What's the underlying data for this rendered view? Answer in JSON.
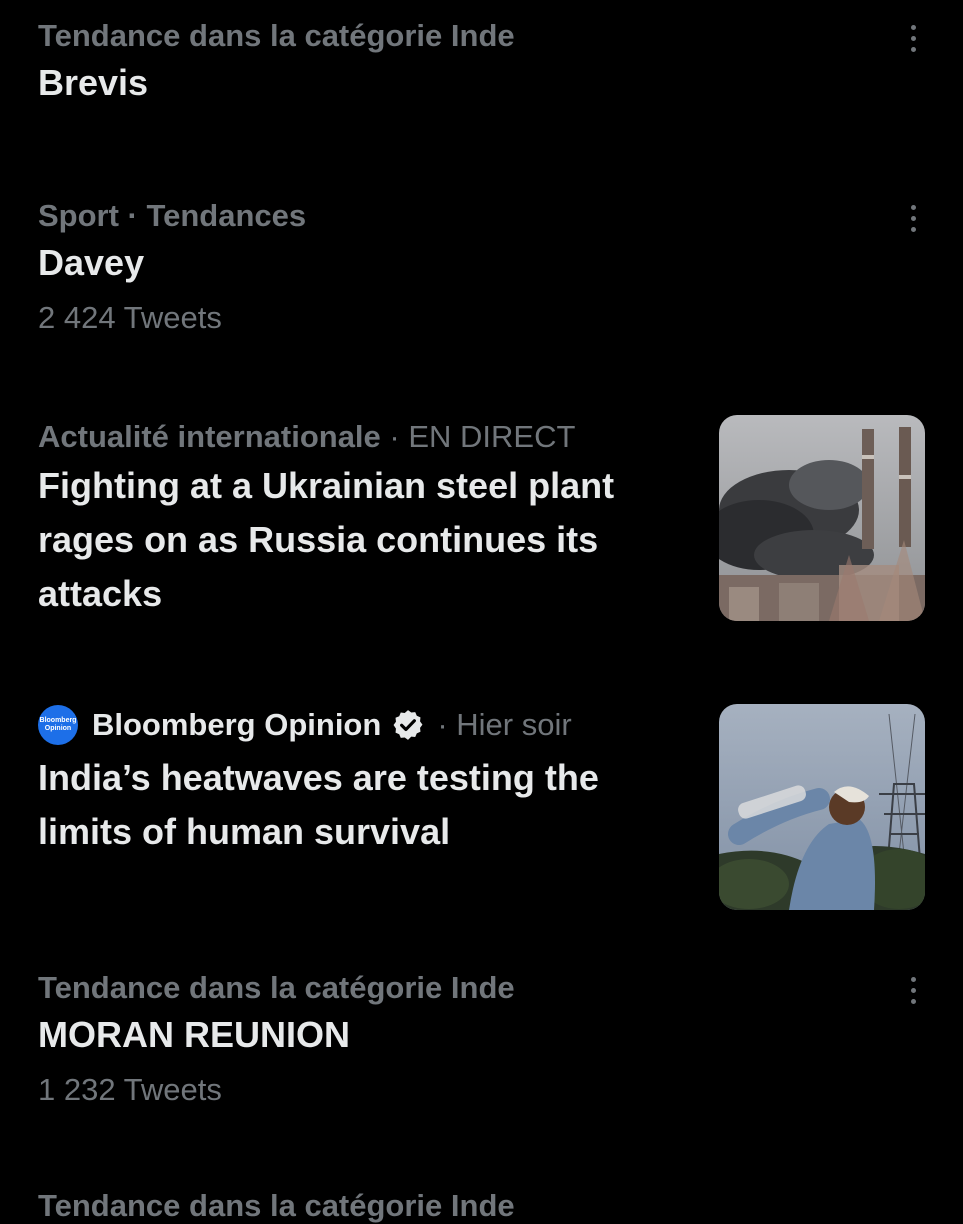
{
  "trends": [
    {
      "category": "Tendance dans la catégorie Inde",
      "name": "Brevis"
    },
    {
      "category": "Sport · Tendances",
      "name": "Davey",
      "count": "2 424 Tweets"
    }
  ],
  "news": [
    {
      "category": "Actualité internationale",
      "status": "· EN DIRECT",
      "title": "Fighting at a Ukrainian steel plant rages on as Russia continues its attacks",
      "image_icon": "smoke-factory-image"
    },
    {
      "source_logo": "Bloomberg Opinion",
      "source": "Bloomberg Opinion",
      "verified_icon": "verified-badge-icon",
      "time": "· Hier soir",
      "title": "India’s heatwaves are testing the limits of human survival",
      "image_icon": "man-drinking-water-image"
    }
  ],
  "trend3": {
    "category": "Tendance dans la catégorie Inde",
    "name": "MORAN REUNION",
    "count": "1 232 Tweets"
  },
  "partial": {
    "category": "Tendance dans la catégorie Inde"
  },
  "colors": {
    "background": "#000000",
    "primary_text": "#e7e9ea",
    "secondary_text": "#71767b",
    "bloomberg_blue": "#1d6fe8"
  }
}
